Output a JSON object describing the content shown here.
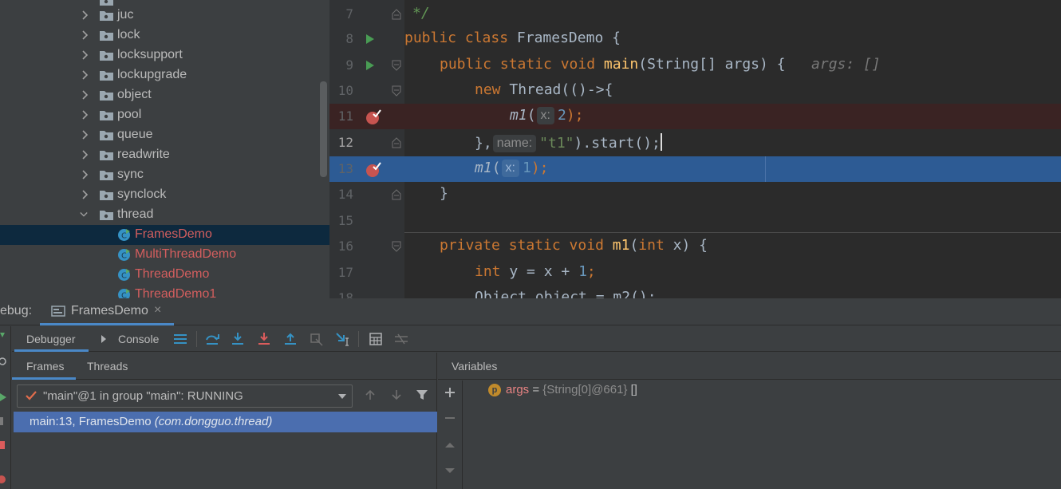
{
  "project_tree": {
    "top_partial": "···",
    "folders": [
      "juc",
      "lock",
      "locksupport",
      "lockupgrade",
      "object",
      "pool",
      "queue",
      "readwrite",
      "sync",
      "synclock",
      "thread"
    ],
    "classes": [
      "FramesDemo",
      "MultiThreadDemo",
      "ThreadDemo",
      "ThreadDemo1"
    ],
    "selected": "FramesDemo"
  },
  "editor": {
    "line_numbers": [
      "7",
      "8",
      "9",
      "10",
      "11",
      "12",
      "13",
      "14",
      "15",
      "16",
      "17",
      "18"
    ],
    "code": {
      "l7_comment": "*/",
      "l8_public": "public",
      "l8_class": "class",
      "l8_name": "FramesDemo",
      "l8_brace": " {",
      "l9_mods": "public static void",
      "l9_main": "main",
      "l9_sig": "(String[] args) {",
      "l9_hint": "args: []",
      "l10_new": "new",
      "l10_rest": " Thread(()->{",
      "l11_call": "m1",
      "l11_open": "(",
      "l11_param": "x:",
      "l11_arg": "2",
      "l11_close": ");",
      "l12_close": "},",
      "l12_param": "name:",
      "l12_str": "\"t1\"",
      "l12_rest": ").start();",
      "l13_call": "m1",
      "l13_open": "(",
      "l13_param": "x:",
      "l13_arg": "1",
      "l13_close": ");",
      "l14": "}",
      "l16_mods": "private static void",
      "l16_name": "m1",
      "l16_open": "(",
      "l16_int": "int",
      "l16_rest": " x) {",
      "l17_int": "int",
      "l17_rest": " y = x + ",
      "l17_num": "1",
      "l17_semi": ";",
      "l18_partial": "Object object = m2();"
    }
  },
  "debug": {
    "title_label": "ebug:",
    "run_config_tab": "FramesDemo",
    "close_glyph": "×",
    "tabs": {
      "debugger": "Debugger",
      "console": "Console"
    },
    "frames_subtabs": {
      "frames": "Frames",
      "threads": "Threads"
    },
    "thread_selector": "\"main\"@1 in group \"main\": RUNNING",
    "frame": {
      "location": "main:13, FramesDemo",
      "package": "(com.dongguo.thread)"
    },
    "variables_header": "Variables",
    "variables": [
      {
        "badge": "p",
        "name": "args",
        "equals": " = ",
        "type": "{String[0]@661}",
        "value": "[]"
      }
    ]
  },
  "colors": {
    "tree_bg": "#3c3f41",
    "tree_selected": "#0d293e",
    "editor_bg": "#2b2b2b",
    "breakpoint_line": "#3a2323",
    "execution_line": "#2d5b94",
    "keyword": "#cc7832",
    "function": "#ffc66d",
    "frame_selected": "#4b6eaf",
    "tab_underline": "#4a88c7"
  }
}
